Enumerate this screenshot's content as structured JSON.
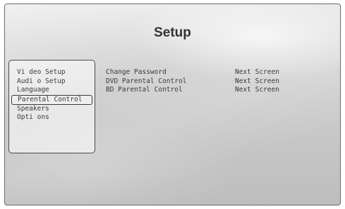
{
  "header": {
    "title": "Setup"
  },
  "menu": {
    "items": [
      {
        "label": "Vi deo Setup",
        "selected": false
      },
      {
        "label": "Audi o Setup",
        "selected": false
      },
      {
        "label": "Language",
        "selected": false
      },
      {
        "label": "Parental Control",
        "selected": true
      },
      {
        "label": "Speakers",
        "selected": false
      },
      {
        "label": "Opti ons",
        "selected": false
      }
    ]
  },
  "submenu": {
    "rows": [
      {
        "label": "Change Password",
        "value": "Next Screen"
      },
      {
        "label": "DVD Parental Control",
        "value": "Next Screen"
      },
      {
        "label": "BD Parental Control",
        "value": "Next Screen"
      }
    ]
  }
}
